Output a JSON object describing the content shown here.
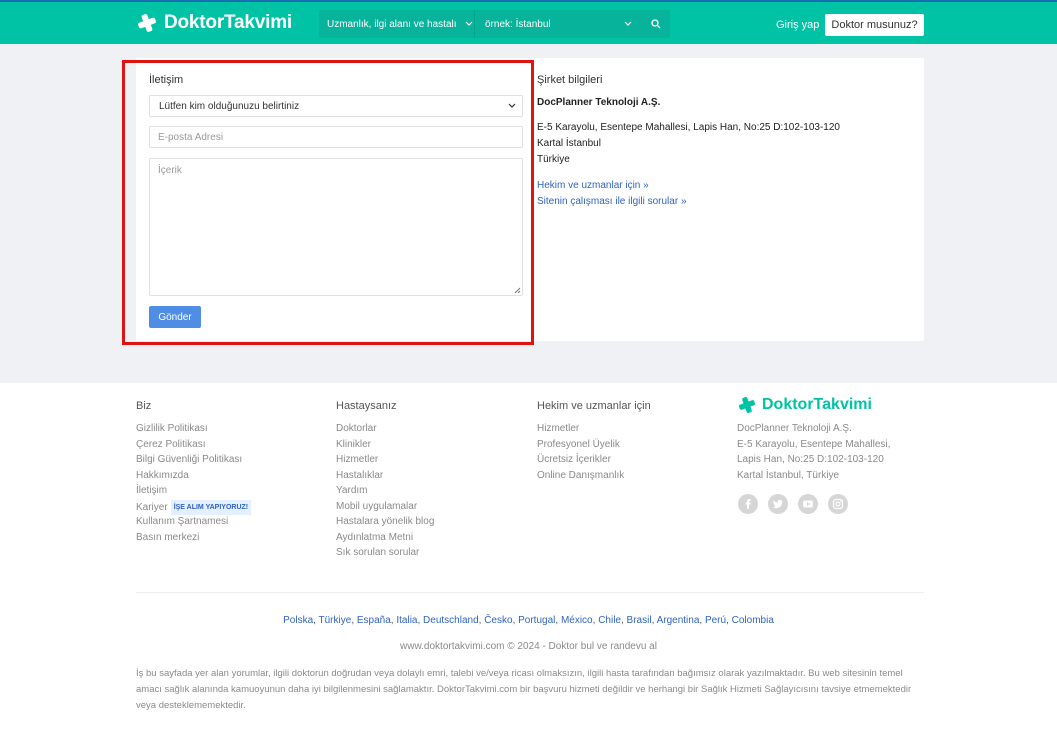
{
  "header": {
    "logo_text": "DoktorTakvimi",
    "search_specialty": "Uzmanlık, ilgi alanı ve hastalı",
    "search_location_placeholder": "örnek: İstanbul",
    "login_label": "Giriş yap",
    "doctor_button": "Doktor musunuz?"
  },
  "contact_form": {
    "title": "İletişim",
    "select_value": "Lütfen kim olduğunuzu belirtiniz",
    "email_placeholder": "E-posta Adresi",
    "content_placeholder": "İçerik",
    "submit_label": "Gönder"
  },
  "company_info": {
    "title": "Şirket bilgileri",
    "name": "DocPlanner Teknoloji A.Ş.",
    "address_line1": "E-5 Karayolu, Esentepe Mahallesi, Lapis Han, No:25 D:102-103-120",
    "address_line2": "Kartal İstanbul",
    "address_line3": "Türkiye",
    "link1": "Hekim ve uzmanlar için »",
    "link2": "Sitenin çalışması ile ilgili sorular »"
  },
  "footer": {
    "col1": {
      "heading": "Biz",
      "items": [
        "Gizlilik Politikası",
        "Çerez Politikası",
        "Bilgi Güvenliği Politikası",
        "Hakkımızda",
        "İletişim",
        "Kariyer",
        "Kullanım Şartnamesi",
        "Basın merkezi"
      ],
      "badge": "İŞE ALIM YAPIYORUZ!"
    },
    "col2": {
      "heading": "Hastaysanız",
      "items": [
        "Doktorlar",
        "Klinikler",
        "Hizmetler",
        "Hastalıklar",
        "Yardım",
        "Mobil uygulamalar",
        "Hastalara yönelik blog",
        "Aydınlatma Metni",
        "Sık sorulan sorular"
      ]
    },
    "col3": {
      "heading": "Hekim ve uzmanlar için",
      "items": [
        "Hizmetler",
        "Profesyonel Üyelik",
        "Ücretsiz İçerikler",
        "Online Danışmanlık"
      ]
    },
    "col4": {
      "logo_text": "DoktorTakvimi",
      "address": [
        "DocPlanner Teknoloji A.Ş.",
        "E-5 Karayolu, Esentepe Mahallesi,",
        "Lapis Han, No:25 D:102-103-120",
        "Kartal İstanbul, Türkiye"
      ]
    },
    "social_icons": [
      "facebook-icon",
      "twitter-icon",
      "youtube-icon",
      "instagram-icon"
    ],
    "countries": [
      "Polska",
      "Türkiye",
      "España",
      "Italia",
      "Deutschland",
      "Česko",
      "Portugal",
      "México",
      "Chile",
      "Brasil",
      "Argentina",
      "Perú",
      "Colombia"
    ],
    "copyright": "www.doktortakvimi.com © 2024 - Doktor bul ve randevu al",
    "disclaimer": "İş bu sayfada yer alan yorumlar, ilgili doktorun doğrudan veya dolaylı emri, talebi ve/veya ricası olmaksızın, ilgili hasta tarafından bağımsız olarak yazılmaktadır. Bu web sitesinin temel amacı sağlık alanında kamuoyunun daha iyi bilgilenmesini sağlamaktır. DoktorTakvimi.com bir başvuru hizmeti değildir ve herhangi bir Sağlık Hizmeti Sağlayıcısını tavsiye etmemektedir veya desteklememektedir."
  },
  "colors": {
    "brand": "#00c3a5",
    "link": "#2f64c1",
    "button": "#4f8ee4",
    "highlight": "#e01313"
  }
}
